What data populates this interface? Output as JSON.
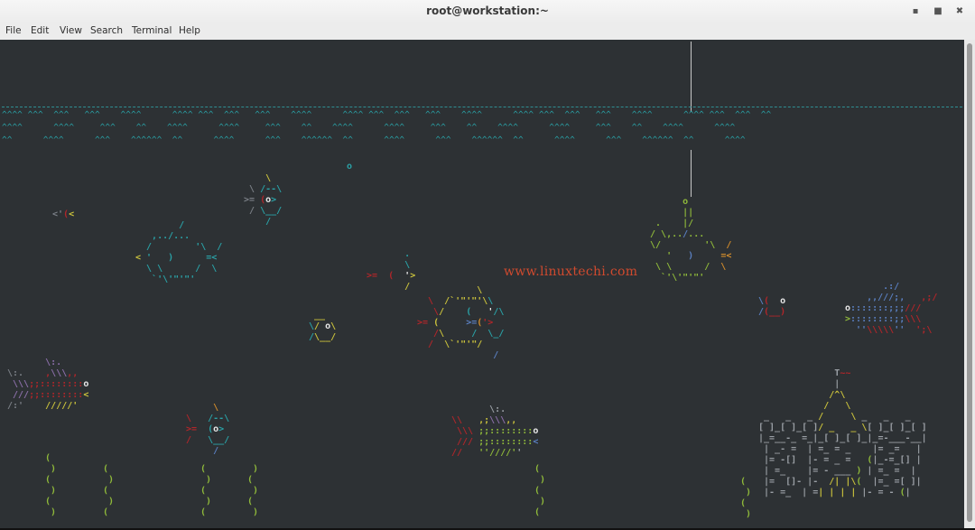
{
  "window": {
    "title": "root@workstation:~",
    "controls": {
      "minimize": "▪",
      "maximize": "■",
      "close": "✖"
    }
  },
  "menubar": {
    "items": [
      "File",
      "Edit",
      "View",
      "Search",
      "Terminal",
      "Help"
    ]
  },
  "terminal": {
    "program": "asciiquarium",
    "watermark": "www.linuxtechi.com",
    "bubble": "o",
    "waves": [
      "^^^^ ^^^  ^^^   ^^^    ^^^^      ^^^^ ^^^  ^^^   ^^^    ^^^^      ^^^^ ^^^  ^^^   ^^^    ^^^^      ^^^^ ^^^  ^^^   ^^^    ^^^^      ^^^^ ^^^  ^^^  ^^",
      "^^^^      ^^^^     ^^^    ^^    ^^^^      ^^^^     ^^^    ^^    ^^^^      ^^^^     ^^^    ^^    ^^^^      ^^^^     ^^^    ^^    ^^^^      ^^^^",
      "^^      ^^^^      ^^^    ^^^^^^  ^^      ^^^^      ^^^    ^^^^^^  ^^      ^^^^      ^^^    ^^^^^^  ^^      ^^^^      ^^^    ^^^^^^  ^^      ^^^^"
    ],
    "scrollbar": {
      "position": 1.0
    }
  }
}
